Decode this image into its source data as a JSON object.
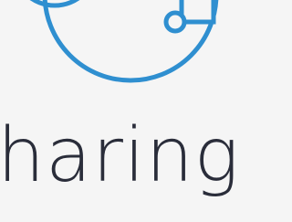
{
  "logo": {
    "icon_name": "sharing-logo-icon",
    "accent_color": "#2f8fd0",
    "text_color": "#2a2d3a",
    "background_color": "#f5f5f5"
  },
  "wordmark": {
    "text": "haring"
  }
}
